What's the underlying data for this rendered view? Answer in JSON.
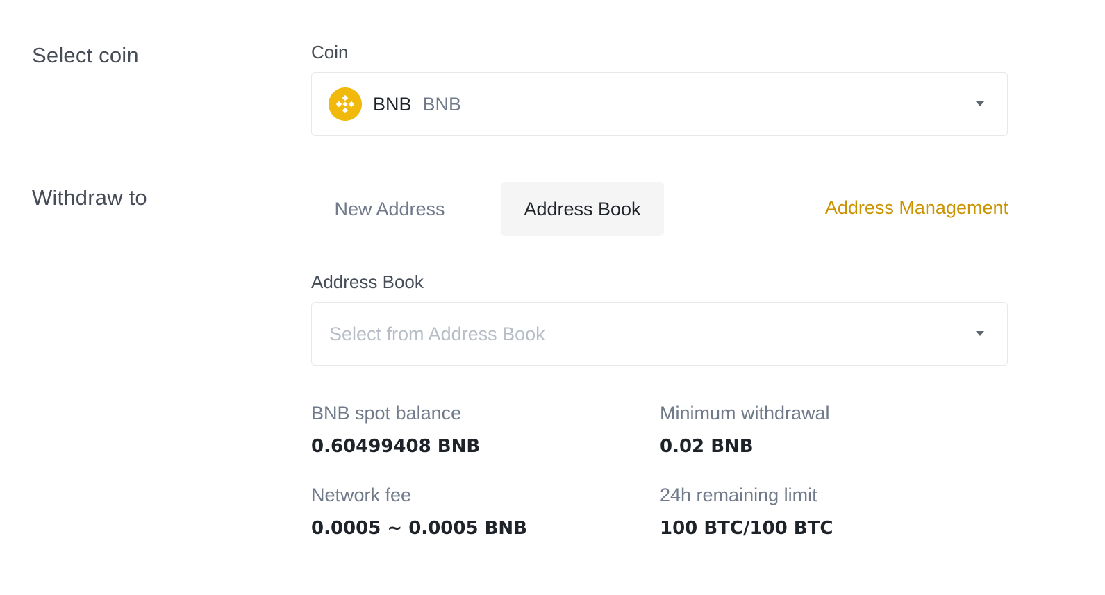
{
  "labels": {
    "select_coin": "Select coin",
    "withdraw_to": "Withdraw to"
  },
  "coin": {
    "field_label": "Coin",
    "selected_symbol": "BNB",
    "selected_name": "BNB",
    "icon": "bnb-logo-icon",
    "icon_color": "#F0B90B"
  },
  "tabs": {
    "new_address": "New Address",
    "address_book": "Address Book",
    "active": "address_book"
  },
  "address_management_link": "Address Management",
  "address_book": {
    "field_label": "Address Book",
    "placeholder": "Select from Address Book"
  },
  "info": {
    "balance_label": "BNB spot balance",
    "balance_value": "0.60499408 BNB",
    "min_withdrawal_label": "Minimum withdrawal",
    "min_withdrawal_value": "0.02 BNB",
    "network_fee_label": "Network fee",
    "network_fee_value": "0.0005 ~ 0.0005 BNB",
    "limit_label": "24h remaining limit",
    "limit_value": "100 BTC/100 BTC"
  },
  "colors": {
    "accent": "#C99400",
    "text_primary": "#1E2329",
    "text_secondary": "#707A8A",
    "tab_active_bg": "#F5F5F5"
  }
}
